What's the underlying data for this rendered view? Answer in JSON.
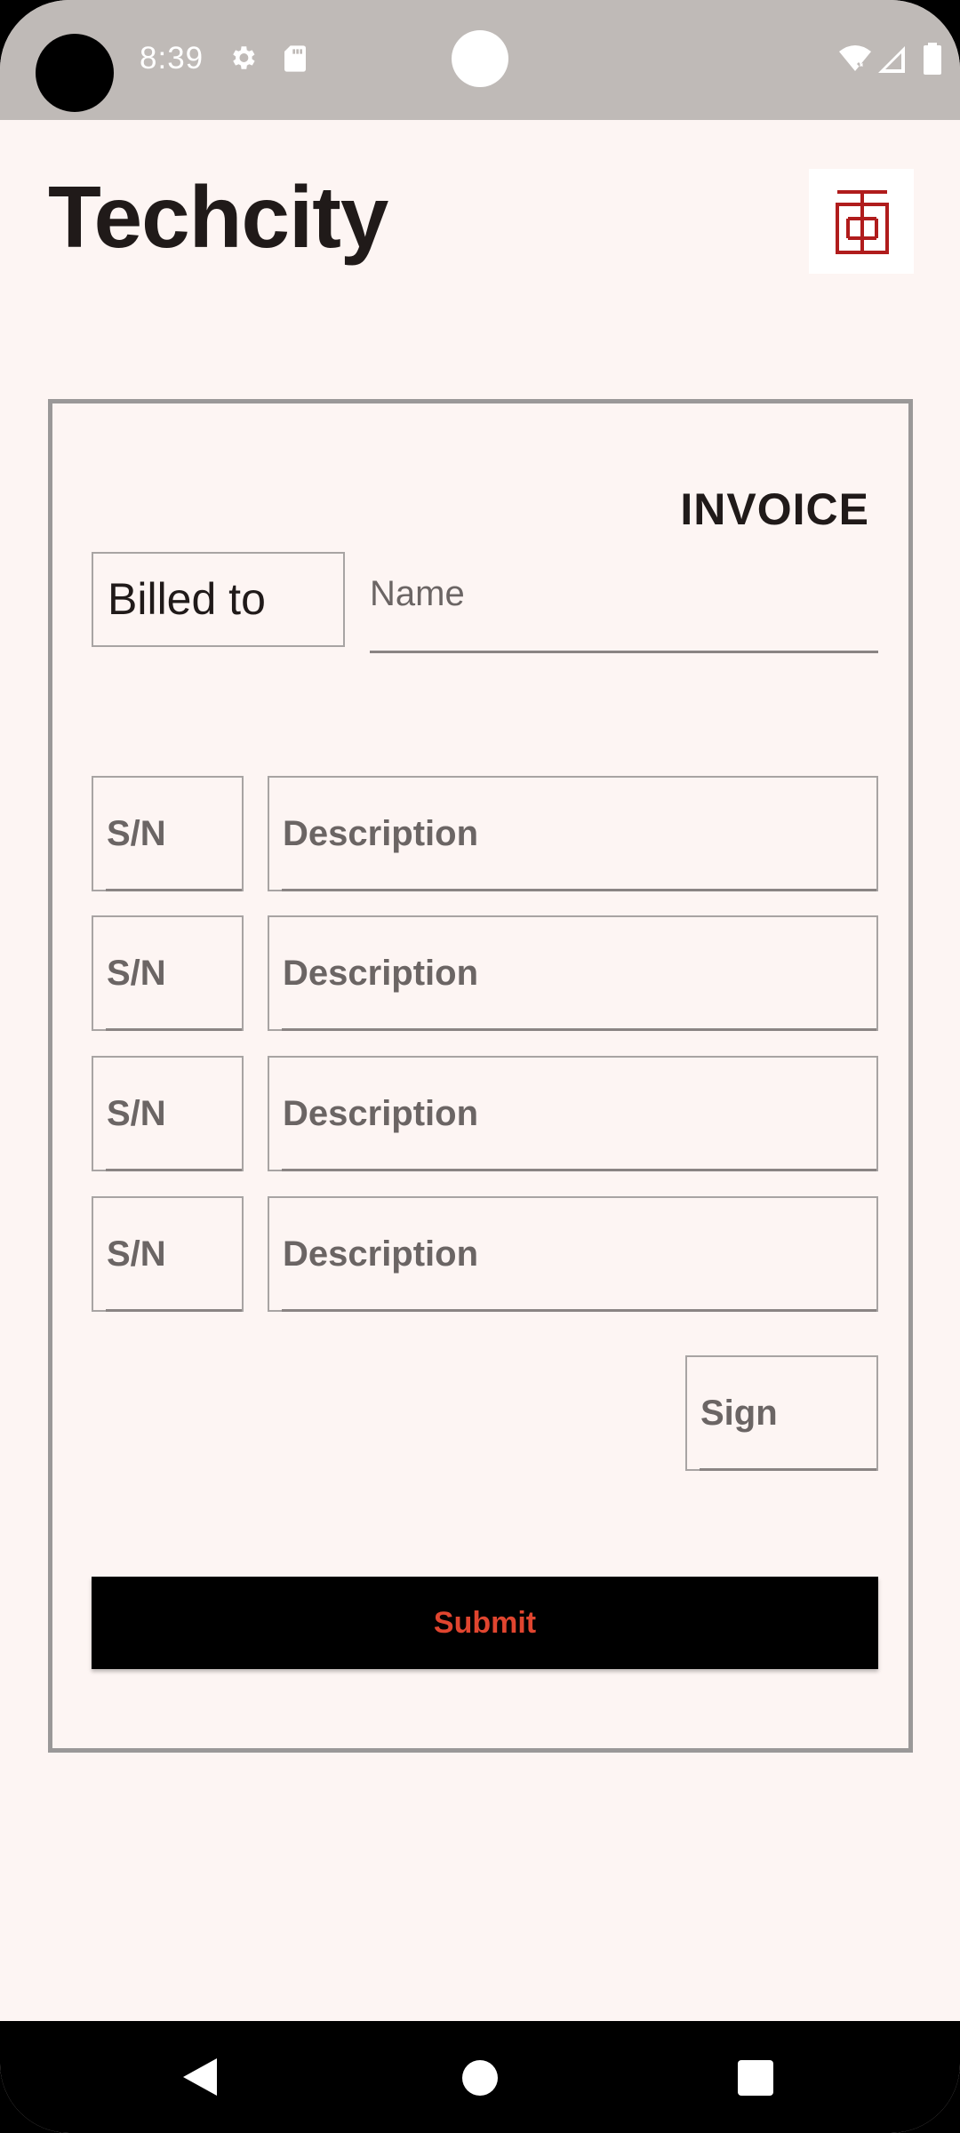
{
  "status_bar": {
    "time": "8:39",
    "icons": [
      "gear-icon",
      "sd-card-icon",
      "wifi-off-icon",
      "signal-icon",
      "battery-icon"
    ]
  },
  "header": {
    "title": "Techcity",
    "logo_icon": "seal-logo-icon",
    "logo_color": "#b01c1c"
  },
  "invoice": {
    "heading": "INVOICE",
    "billed_to_label": "Billed to",
    "name_placeholder": "Name",
    "items": [
      {
        "sn_placeholder": "S/N",
        "description_placeholder": "Description"
      },
      {
        "sn_placeholder": "S/N",
        "description_placeholder": "Description"
      },
      {
        "sn_placeholder": "S/N",
        "description_placeholder": "Description"
      },
      {
        "sn_placeholder": "S/N",
        "description_placeholder": "Description"
      }
    ],
    "sign_placeholder": "Sign",
    "submit_label": "Submit"
  },
  "colors": {
    "background": "#fdf5f3",
    "status_bar": "#bfbab7",
    "submit_text": "#e0452f",
    "submit_bg": "#000000"
  },
  "nav_bar": {
    "buttons": [
      "back-icon",
      "home-icon",
      "recents-icon"
    ]
  }
}
